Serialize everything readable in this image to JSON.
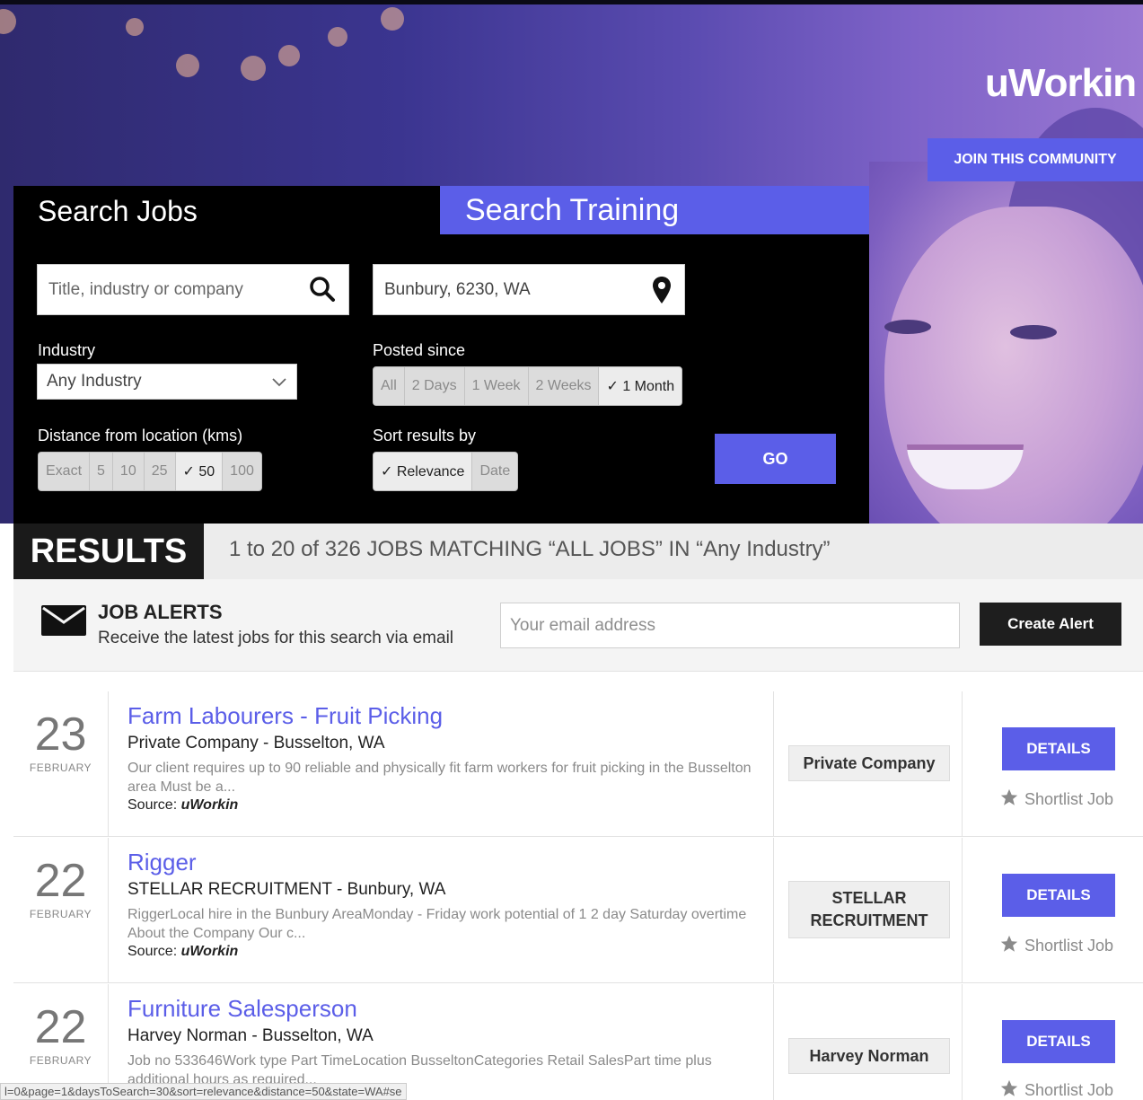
{
  "header": {
    "brand": "uWorkin",
    "join_label": "JOIN THIS COMMUNITY"
  },
  "search": {
    "tab_jobs": "Search Jobs",
    "tab_training": "Search Training",
    "keyword_placeholder": "Title, industry or company",
    "location_value": "Bunbury, 6230, WA",
    "industry_label": "Industry",
    "industry_value": "Any Industry",
    "posted_label": "Posted since",
    "posted_options": [
      "All",
      "2 Days",
      "1 Week",
      "2 Weeks",
      "✓ 1 Month"
    ],
    "distance_label": "Distance from location (kms)",
    "distance_options": [
      "Exact",
      "5",
      "10",
      "25",
      "✓ 50",
      "100"
    ],
    "sort_label": "Sort results by",
    "sort_options": [
      "✓ Relevance",
      "Date"
    ],
    "go_label": "GO"
  },
  "results": {
    "label": "RESULTS",
    "summary": "1 to 20 of 326 JOBS MATCHING “ALL JOBS” IN “Any Industry”"
  },
  "alerts": {
    "title": "JOB ALERTS",
    "subtitle": "Receive the latest jobs for this search via email",
    "email_placeholder": "Your email address",
    "create_label": "Create Alert"
  },
  "jobs": [
    {
      "day": "23",
      "month": "FEBRUARY",
      "title": "Farm Labourers - Fruit Picking",
      "company": "Private Company - Busselton, WA",
      "description": "Our client requires up to 90 reliable and physically fit farm workers for fruit picking in the Busselton area Must be a...",
      "source_label": "Source:",
      "source": "uWorkin",
      "logo_text": "Private Company",
      "details_label": "DETAILS",
      "shortlist_label": "Shortlist Job"
    },
    {
      "day": "22",
      "month": "FEBRUARY",
      "title": "Rigger",
      "company": "STELLAR RECRUITMENT - Bunbury, WA",
      "description": "RiggerLocal hire in the Bunbury AreaMonday - Friday work potential of 1 2 day Saturday overtime About the Company Our c...",
      "source_label": "Source:",
      "source": "uWorkin",
      "logo_text": "STELLAR RECRUITMENT",
      "details_label": "DETAILS",
      "shortlist_label": "Shortlist Job"
    },
    {
      "day": "22",
      "month": "FEBRUARY",
      "title": "Furniture Salesperson",
      "company": "Harvey Norman - Busselton, WA",
      "description": "Job no 533646Work type Part TimeLocation BusseltonCategories Retail SalesPart time plus additional hours as required...",
      "logo_text": "Harvey Norman",
      "details_label": "DETAILS",
      "shortlist_label": "Shortlist Job"
    }
  ],
  "statusbar": {
    "url": "l=0&page=1&daysToSearch=30&sort=relevance&distance=50&state=WA#se"
  },
  "colors": {
    "accent": "#5b5ee8",
    "dark": "#000000"
  }
}
